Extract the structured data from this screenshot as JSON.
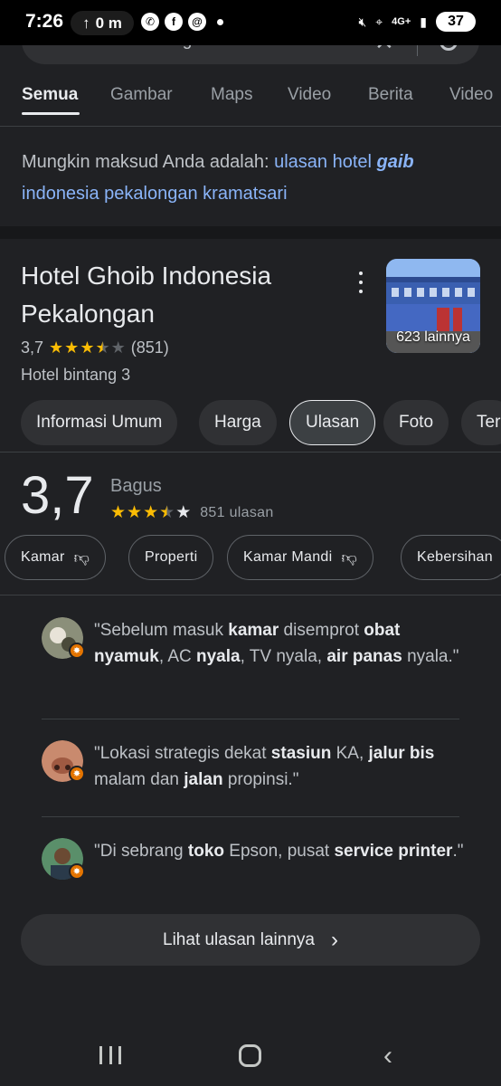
{
  "status_bar": {
    "time": "7:26",
    "upload_label": "0 m",
    "network": "4G+",
    "battery": "37"
  },
  "search": {
    "query": "ulasan hotel ghoib indonesia"
  },
  "tabs": [
    "Semua",
    "Gambar",
    "Maps",
    "Video",
    "Berita",
    "Video"
  ],
  "did_you_mean": {
    "prefix": "Mungkin maksud Anda adalah:",
    "link_before": "ulasan hotel",
    "link_bold": "gaib",
    "link_after": "indonesia pekalongan kramatsari"
  },
  "hotel": {
    "title": "Hotel Ghoib Indonesia Pekalongan",
    "rating": "3,7",
    "rating_value": 3.7,
    "review_count": "(851)",
    "type": "Hotel bintang 3",
    "photo_count": "623 lainnya"
  },
  "chips": [
    "Informasi Umum",
    "Harga",
    "Ulasan",
    "Foto",
    "Ter"
  ],
  "reviews_summary": {
    "score": "3,7",
    "label": "Bagus",
    "count": "851 ulasan"
  },
  "aspects": [
    "Kamar",
    "Properti",
    "Kamar Mandi",
    "Kebersihan"
  ],
  "snippets": [
    [
      {
        "t": "\"Sebelum masuk ",
        "b": false
      },
      {
        "t": "kamar",
        "b": true
      },
      {
        "t": " disemprot ",
        "b": false
      },
      {
        "t": "obat nyamuk",
        "b": true
      },
      {
        "t": ", AC ",
        "b": false
      },
      {
        "t": "nyala",
        "b": true
      },
      {
        "t": ", TV nyala, ",
        "b": false
      },
      {
        "t": "air panas",
        "b": true
      },
      {
        "t": " nyala.\"",
        "b": false
      }
    ],
    [
      {
        "t": "\"Lokasi strategis dekat ",
        "b": false
      },
      {
        "t": "stasiun",
        "b": true
      },
      {
        "t": " KA, ",
        "b": false
      },
      {
        "t": "jalur bis",
        "b": true
      },
      {
        "t": " malam dan ",
        "b": false
      },
      {
        "t": "jalan",
        "b": true
      },
      {
        "t": " propinsi.\"",
        "b": false
      }
    ],
    [
      {
        "t": "\"Di sebrang ",
        "b": false
      },
      {
        "t": "toko",
        "b": true
      },
      {
        "t": " Epson, pusat ",
        "b": false
      },
      {
        "t": "service printer",
        "b": true
      },
      {
        "t": ".\"",
        "b": false
      }
    ]
  ],
  "more_button": "Lihat ulasan lainnya",
  "colors": {
    "background": "#202124",
    "link": "#8ab4f8",
    "star": "#fbbc04",
    "badge": "#e37400"
  }
}
